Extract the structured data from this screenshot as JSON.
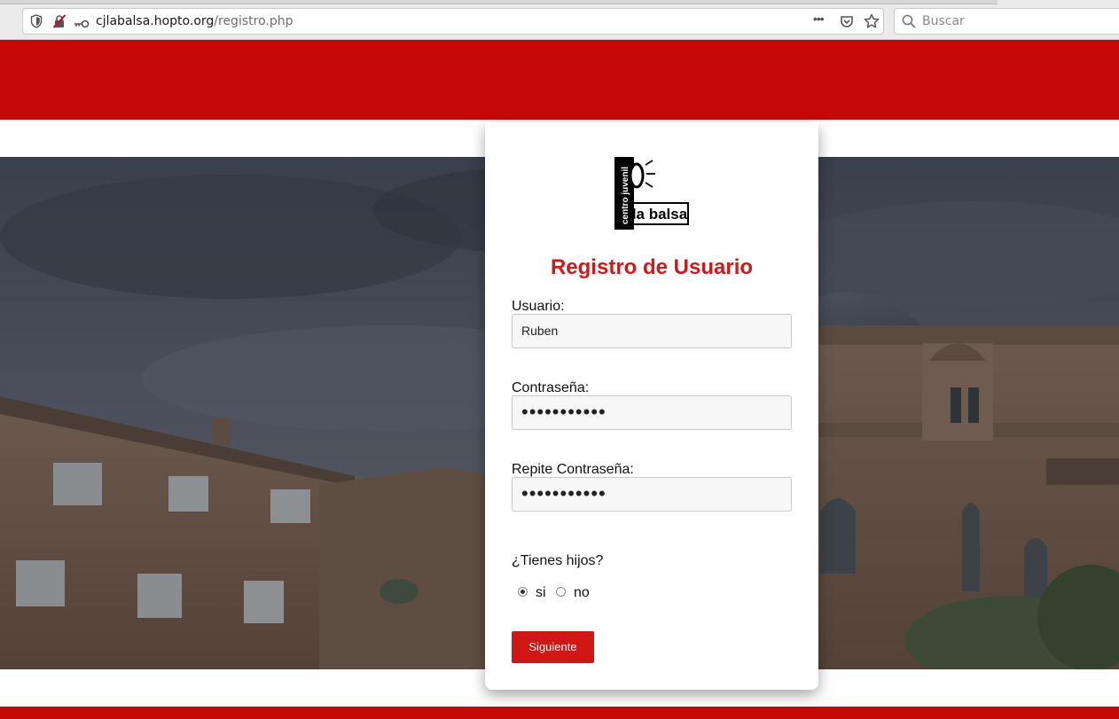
{
  "browser": {
    "url_host": "cjlabalsa.hopto.org",
    "url_path": "/registro.php",
    "search_placeholder": "Buscar",
    "menu_dots": "•••"
  },
  "logo": {
    "text_main": "la balsa",
    "text_side": "centro juvenil"
  },
  "form": {
    "title": "Registro de Usuario",
    "usuario_label": "Usuario:",
    "usuario_value": "Ruben",
    "password_label": "Contraseña:",
    "password_value": "•••••••••••",
    "repeat_label": "Repite Contraseña:",
    "repeat_value": "•••••••••••",
    "hijos_label": "¿Tienes hijos?",
    "option_si": "si",
    "option_no": "no",
    "hijos_selected": "si",
    "next_button": "Siguiente"
  },
  "colors": {
    "brand_red": "#c70808",
    "title_red": "#cf1a1a",
    "button_red": "#d11616"
  }
}
